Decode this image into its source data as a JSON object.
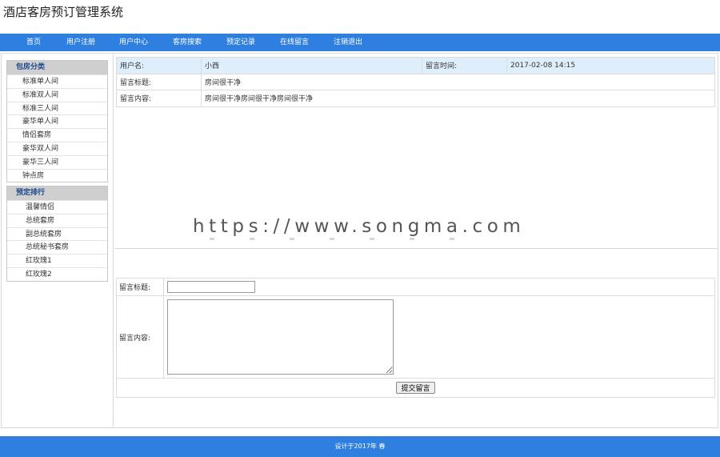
{
  "site": {
    "title": "酒店客房预订管理系统"
  },
  "nav": [
    {
      "label": "首页"
    },
    {
      "label": "用户注册"
    },
    {
      "label": "用户中心"
    },
    {
      "label": "客房搜索"
    },
    {
      "label": "预定记录"
    },
    {
      "label": "在线留言"
    },
    {
      "label": "注销退出"
    }
  ],
  "sidebar": {
    "categories": {
      "title": "包房分类",
      "items": [
        {
          "label": "标准单人间"
        },
        {
          "label": "标准双人间"
        },
        {
          "label": "标准三人间"
        },
        {
          "label": "豪华单人间"
        },
        {
          "label": "情侣套房"
        },
        {
          "label": "豪华双人间"
        },
        {
          "label": "豪华三人间"
        },
        {
          "label": "钟点房"
        }
      ]
    },
    "ranking": {
      "title": "预定排行",
      "items": [
        {
          "label": "温馨情侣"
        },
        {
          "label": "总统套房"
        },
        {
          "label": "副总统套房"
        },
        {
          "label": "总统秘书套房"
        },
        {
          "label": "红玫瑰1"
        },
        {
          "label": "红玫瑰2"
        }
      ]
    }
  },
  "message": {
    "username_label": "用户名:",
    "username": "小西",
    "time_label": "留言时间:",
    "time": "2017-02-08 14:15",
    "title_label": "留言标题:",
    "title": "房间很干净",
    "content_label": "留言内容:",
    "content": "房间很干净房间很干净房间很干净"
  },
  "watermark": "https://www.songma.com",
  "form": {
    "title_label": "留言标题:",
    "title_value": "",
    "content_label": "留言内容:",
    "content_value": "",
    "submit_label": "提交留言"
  },
  "footer": {
    "text": "设计于2017年 春"
  },
  "colors": {
    "primary": "#2f7fe0",
    "header_row": "#dfeefb",
    "sidebar_head": "#cfcfcf"
  }
}
